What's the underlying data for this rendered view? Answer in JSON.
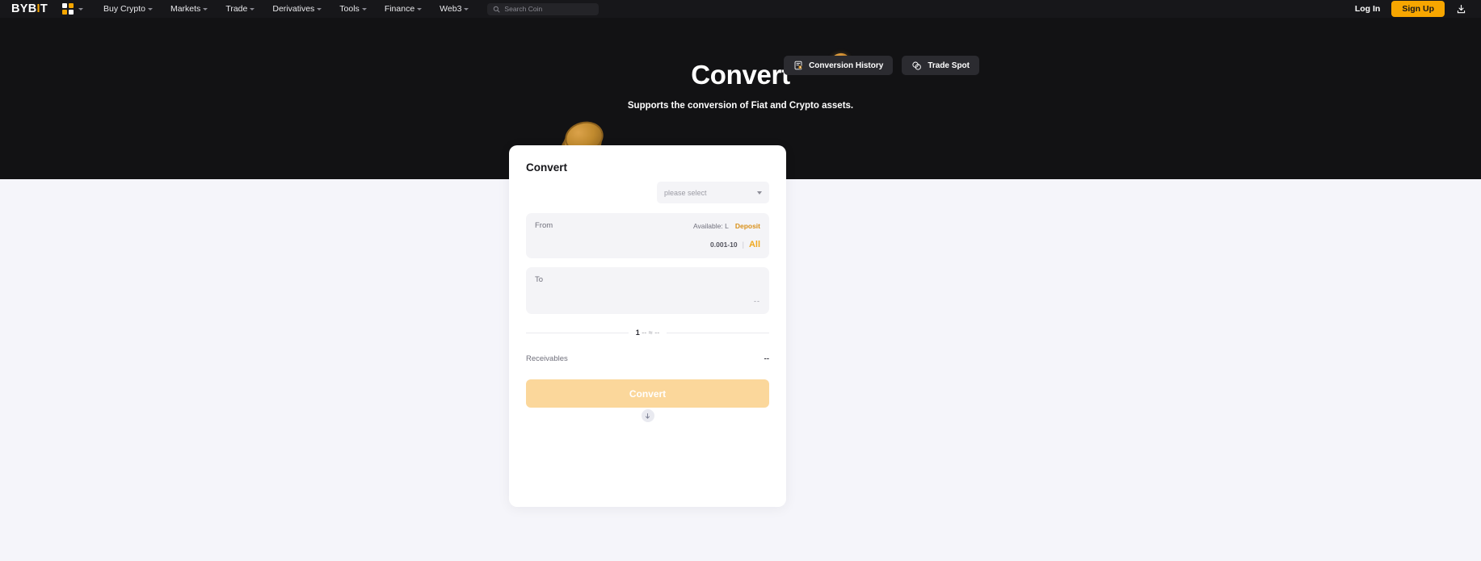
{
  "nav": {
    "logo": {
      "prefix": "BYB",
      "accent": "I",
      "suffix": "T"
    },
    "grid_icon": "apps-grid-icon",
    "items": [
      {
        "label": "Buy Crypto",
        "has_caret": true
      },
      {
        "label": "Markets",
        "has_caret": true
      },
      {
        "label": "Trade",
        "has_caret": true
      },
      {
        "label": "Derivatives",
        "has_caret": true
      },
      {
        "label": "Tools",
        "has_caret": true
      },
      {
        "label": "Finance",
        "has_caret": true
      },
      {
        "label": "Web3",
        "has_caret": true
      }
    ],
    "search": {
      "placeholder": "Search Coin",
      "value": "",
      "icon": "search-icon"
    },
    "login_label": "Log In",
    "signup_label": "Sign Up",
    "download_icon": "download-app-icon"
  },
  "hero": {
    "title": "Convert",
    "subtitle": "Supports the conversion of Fiat and Crypto assets.",
    "actions": [
      {
        "label": "Conversion History",
        "icon": "history-receipt-icon"
      },
      {
        "label": "Trade Spot",
        "icon": "spot-trade-icon"
      }
    ],
    "decor": [
      {
        "name": "coin-small-decoration"
      },
      {
        "name": "coin-stack-decoration"
      }
    ]
  },
  "card": {
    "title": "Convert",
    "account_select": {
      "value": "please select",
      "icon": "chevron-down-icon"
    },
    "from": {
      "label": "From",
      "available_label": "Available:",
      "available_value": "L",
      "deposit_label": "Deposit",
      "amount_value": "",
      "amount_placeholder": "",
      "range_hint": "0.001-10",
      "all_label": "All"
    },
    "swap_icon": "swap-arrow-down-icon",
    "to": {
      "label": "To",
      "amount_value": "--"
    },
    "rate": {
      "lead": "1",
      "from_unit": "--",
      "approx": "≈",
      "to_value": "--"
    },
    "receivables": {
      "label": "Receivables",
      "value": "--"
    },
    "convert_button": {
      "label": "Convert",
      "disabled": true
    }
  },
  "colors": {
    "brand_orange": "#f7a600",
    "nav_bg": "#17171a",
    "hero_bg": "#121214",
    "page_bg": "#f5f5fa",
    "card_bg": "#ffffff",
    "panel_bg": "#f4f4f7",
    "cta_disabled": "#fbd79b",
    "accent_text": "#d99019"
  }
}
